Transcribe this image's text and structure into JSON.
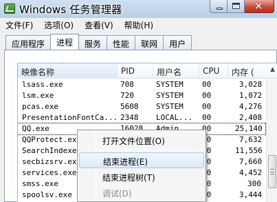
{
  "window": {
    "title": "Windows 任务管理器"
  },
  "menubar": {
    "items": [
      {
        "label": "文件(F)"
      },
      {
        "label": "选项(O)"
      },
      {
        "label": "查看(V)"
      },
      {
        "label": "帮助(H)"
      }
    ]
  },
  "tabs": [
    {
      "label": "应用程序",
      "active": false
    },
    {
      "label": "进程",
      "active": true
    },
    {
      "label": "服务",
      "active": false
    },
    {
      "label": "性能",
      "active": false
    },
    {
      "label": "联网",
      "active": false
    },
    {
      "label": "用户",
      "active": false
    }
  ],
  "table": {
    "columns": [
      "映像名称",
      "PID",
      "用户名",
      "CPU",
      "内存 ("
    ],
    "sorted_column": "映像名称",
    "rows": [
      {
        "name": "lsass.exe",
        "pid": "708",
        "user": "SYSTEM",
        "cpu": "00",
        "mem": "3,028"
      },
      {
        "name": "lsm.exe",
        "pid": "720",
        "user": "SYSTEM",
        "cpu": "00",
        "mem": "1,072"
      },
      {
        "name": "pcas.exe",
        "pid": "5608",
        "user": "SYSTEM",
        "cpu": "00",
        "mem": "4,276"
      },
      {
        "name": "PresentationFontCa...",
        "pid": "2348",
        "user": "LOCAL...",
        "cpu": "00",
        "mem": "2,408"
      },
      {
        "name": "QQ.exe",
        "pid": "16028",
        "user": "Admin...",
        "cpu": "00",
        "mem": "25,140",
        "selected": true
      },
      {
        "name": "QQProtect.exe",
        "pid": "",
        "user": "",
        "cpu": "00",
        "mem": "7,632"
      },
      {
        "name": "SearchIndexer",
        "pid": "",
        "user": "",
        "cpu": "00",
        "mem": "11,556"
      },
      {
        "name": "secbizsrv.exe",
        "pid": "",
        "user": "",
        "cpu": "00",
        "mem": "7,660"
      },
      {
        "name": "services.exe",
        "pid": "",
        "user": "",
        "cpu": "00",
        "mem": "4,452"
      },
      {
        "name": "smss.exe",
        "pid": "",
        "user": "",
        "cpu": "00",
        "mem": "300"
      },
      {
        "name": "spoolsv.exe",
        "pid": "",
        "user": "",
        "cpu": "00",
        "mem": "3,444"
      }
    ]
  },
  "context_menu": {
    "items": [
      {
        "label": "打开文件位置(O)",
        "state": "normal"
      },
      {
        "label": "结束进程(E)",
        "state": "hover"
      },
      {
        "label": "结束进程树(T)",
        "state": "normal"
      },
      {
        "label": "调试(D)",
        "state": "disabled"
      }
    ]
  }
}
